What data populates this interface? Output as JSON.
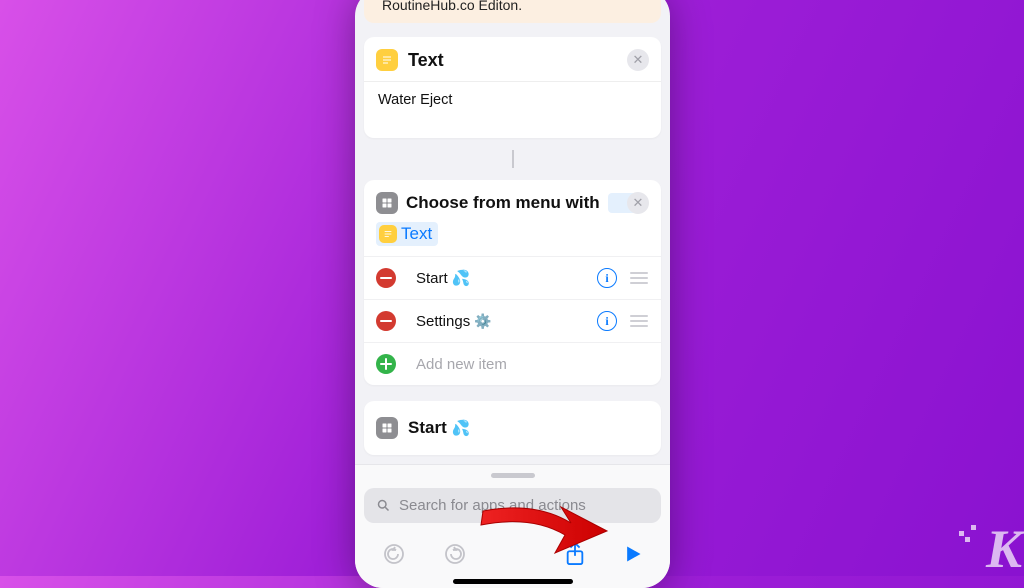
{
  "banner": {
    "text": "RoutineHub.co Editon."
  },
  "text_block": {
    "title": "Text",
    "value": "Water Eject"
  },
  "choose_menu": {
    "title_pre": "Choose from menu with",
    "param_label": "Text",
    "items": [
      {
        "label": "Start",
        "emoji": "💦"
      },
      {
        "label": "Settings",
        "emoji": "⚙️"
      }
    ],
    "add_label": "Add new item"
  },
  "start_block": {
    "title": "Start",
    "emoji": "💦"
  },
  "search": {
    "placeholder": "Search for apps and actions"
  },
  "watermark": "K"
}
